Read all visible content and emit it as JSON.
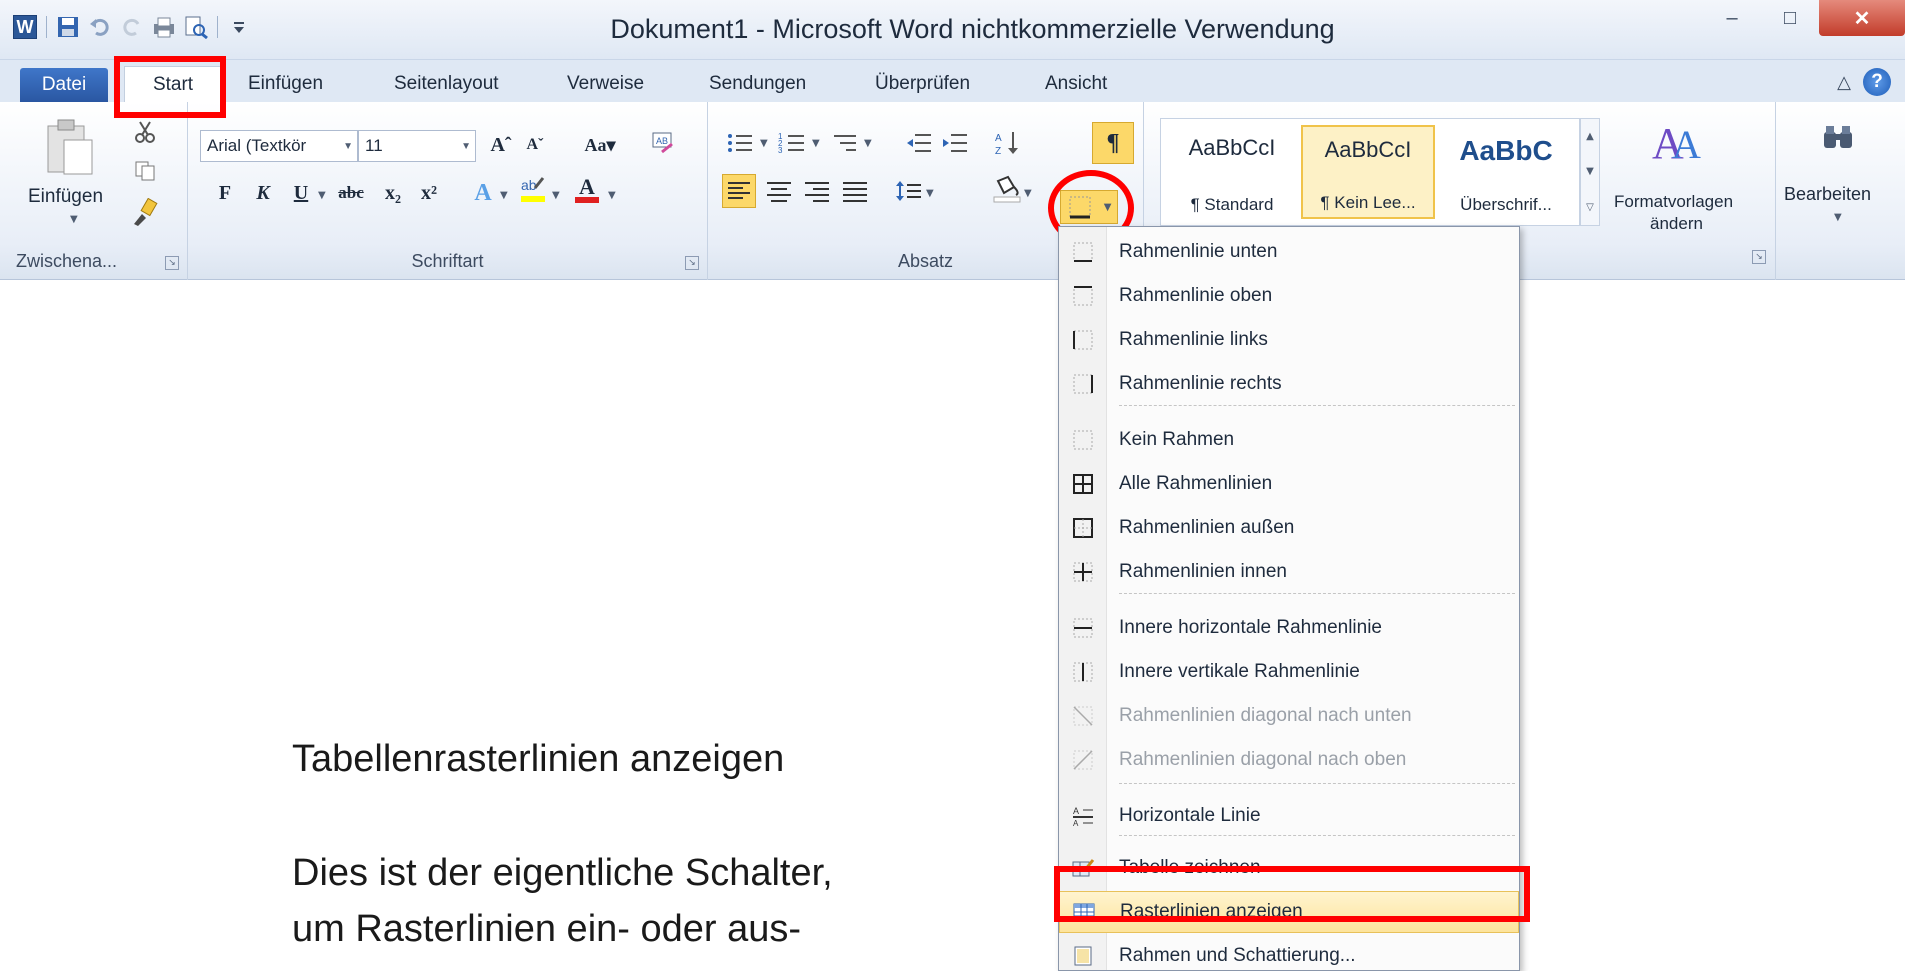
{
  "window": {
    "title": "Dokument1  -  Microsoft Word nichtkommerzielle Verwendung",
    "app_icon": "W",
    "minimize": "–",
    "maximize": "□",
    "close": "✕"
  },
  "tabs": {
    "file": "Datei",
    "items": [
      "Start",
      "Einfügen",
      "Seitenlayout",
      "Verweise",
      "Sendungen",
      "Überprüfen",
      "Ansicht"
    ]
  },
  "ribbon": {
    "clipboard": {
      "paste": "Einfügen",
      "label": "Zwischena..."
    },
    "font": {
      "name": "Arial (Textkör",
      "size": "11",
      "label": "Schriftart",
      "bold": "F",
      "italic": "K",
      "underline": "U"
    },
    "paragraph": {
      "label": "Absatz",
      "pilcrow": "¶"
    },
    "styles": {
      "tiles": [
        {
          "sample": "AaBbCcI",
          "name": "¶ Standard"
        },
        {
          "sample": "AaBbCcI",
          "name": "¶ Kein Lee..."
        },
        {
          "sample": "AaBbC",
          "name": "Überschrif..."
        }
      ],
      "change": "Formatvorlagen",
      "change2": "ändern"
    },
    "editing": {
      "label": "Bearbeiten"
    }
  },
  "menu": {
    "items": [
      {
        "label": "Rahmenlinie unten",
        "icon": "border-bottom-icon",
        "disabled": false
      },
      {
        "label": "Rahmenlinie oben",
        "icon": "border-top-icon",
        "disabled": false
      },
      {
        "label": "Rahmenlinie links",
        "icon": "border-left-icon",
        "disabled": false
      },
      {
        "label": "Rahmenlinie rechts",
        "icon": "border-right-icon",
        "disabled": false
      },
      {
        "label": "Kein Rahmen",
        "icon": "no-border-icon",
        "disabled": false
      },
      {
        "label": "Alle Rahmenlinien",
        "icon": "all-borders-icon",
        "disabled": false
      },
      {
        "label": "Rahmenlinien außen",
        "icon": "outside-borders-icon",
        "disabled": false
      },
      {
        "label": "Rahmenlinien innen",
        "icon": "inside-borders-icon",
        "disabled": false
      },
      {
        "label": "Innere horizontale Rahmenlinie",
        "icon": "inside-horizontal-icon",
        "disabled": false
      },
      {
        "label": "Innere vertikale Rahmenlinie",
        "icon": "inside-vertical-icon",
        "disabled": false
      },
      {
        "label": "Rahmenlinien diagonal nach unten",
        "icon": "diagonal-down-icon",
        "disabled": true
      },
      {
        "label": "Rahmenlinien diagonal nach oben",
        "icon": "diagonal-up-icon",
        "disabled": true
      },
      {
        "label": "Horizontale Linie",
        "icon": "horizontal-line-icon",
        "disabled": false
      },
      {
        "label": "Tabelle zeichnen",
        "icon": "draw-table-icon",
        "disabled": false
      },
      {
        "label": "Rasterlinien anzeigen",
        "icon": "view-gridlines-icon",
        "disabled": false
      },
      {
        "label": "Rahmen und Schattierung...",
        "icon": "borders-shading-icon",
        "disabled": false
      }
    ]
  },
  "annotation": {
    "heading": "Tabellenrasterlinien anzeigen",
    "line1": "Dies ist der eigentliche Schalter,",
    "line2": "um Rasterlinien ein- oder aus-"
  },
  "colors": {
    "accent_highlight": "#fcd869",
    "annotation_red": "#ff0000",
    "file_tab": "#2a57a2"
  }
}
